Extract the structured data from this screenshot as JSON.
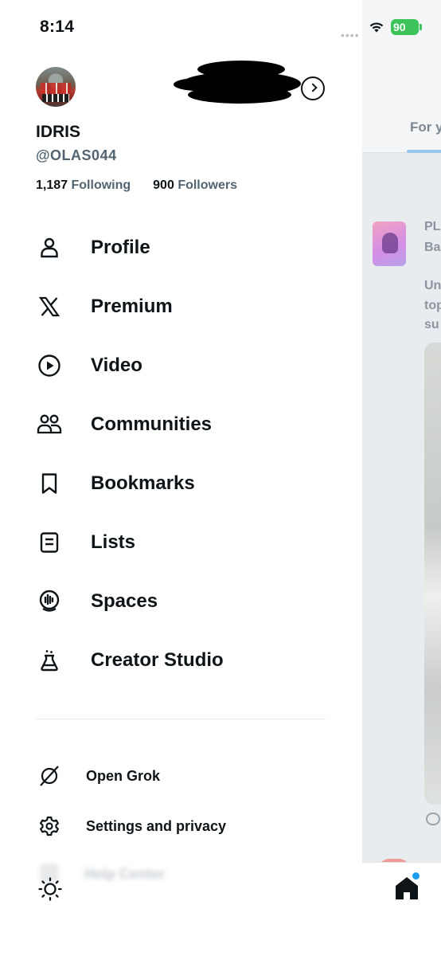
{
  "status_bar": {
    "time": "8:14",
    "battery": "90"
  },
  "profile": {
    "name": "IDRIS",
    "handle": "@OLAS044",
    "following_count": "1,187",
    "following_label": "Following",
    "followers_count": "900",
    "followers_label": "Followers"
  },
  "menu": [
    {
      "label": "Profile",
      "icon": "person-icon"
    },
    {
      "label": "Premium",
      "icon": "x-logo-icon"
    },
    {
      "label": "Video",
      "icon": "play-circle-icon"
    },
    {
      "label": "Communities",
      "icon": "people-icon"
    },
    {
      "label": "Bookmarks",
      "icon": "bookmark-icon"
    },
    {
      "label": "Lists",
      "icon": "list-icon"
    },
    {
      "label": "Spaces",
      "icon": "microphone-icon"
    },
    {
      "label": "Creator Studio",
      "icon": "flask-icon"
    }
  ],
  "secondary_menu": [
    {
      "label": "Open Grok",
      "icon": "grok-icon"
    },
    {
      "label": "Settings and privacy",
      "icon": "gear-icon"
    },
    {
      "label": "Help Center",
      "icon": "help-icon"
    }
  ],
  "feed_peek": {
    "tab": "For y",
    "lines": [
      "PL",
      "Ba",
      "Un",
      "top",
      "su"
    ]
  },
  "colors": {
    "accent": "#1d9bf0",
    "secondary_text": "#536471",
    "battery": "#3cc45a"
  }
}
